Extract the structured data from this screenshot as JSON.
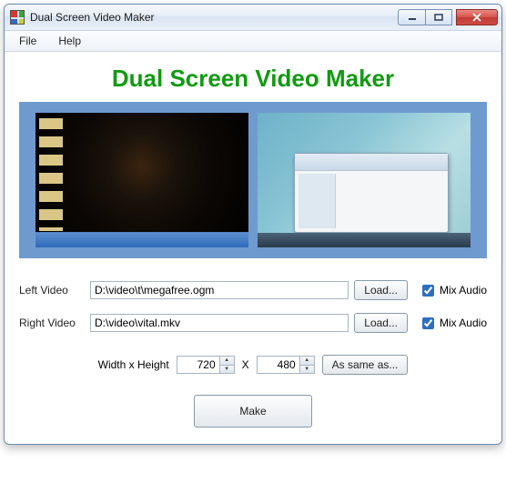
{
  "window": {
    "title": "Dual Screen Video Maker"
  },
  "menu": {
    "file": "File",
    "help": "Help"
  },
  "heading": "Dual Screen Video Maker",
  "left": {
    "label": "Left Video",
    "path": "D:\\video\\t\\megafree.ogm",
    "load": "Load...",
    "mix": "Mix Audio",
    "mix_checked": true
  },
  "right": {
    "label": "Right Video",
    "path": "D:\\video\\vital.mkv",
    "load": "Load...",
    "mix": "Mix Audio",
    "mix_checked": true
  },
  "dims": {
    "label": "Width x Height",
    "width": "720",
    "sep": "X",
    "height": "480",
    "same": "As same as..."
  },
  "make": "Make"
}
